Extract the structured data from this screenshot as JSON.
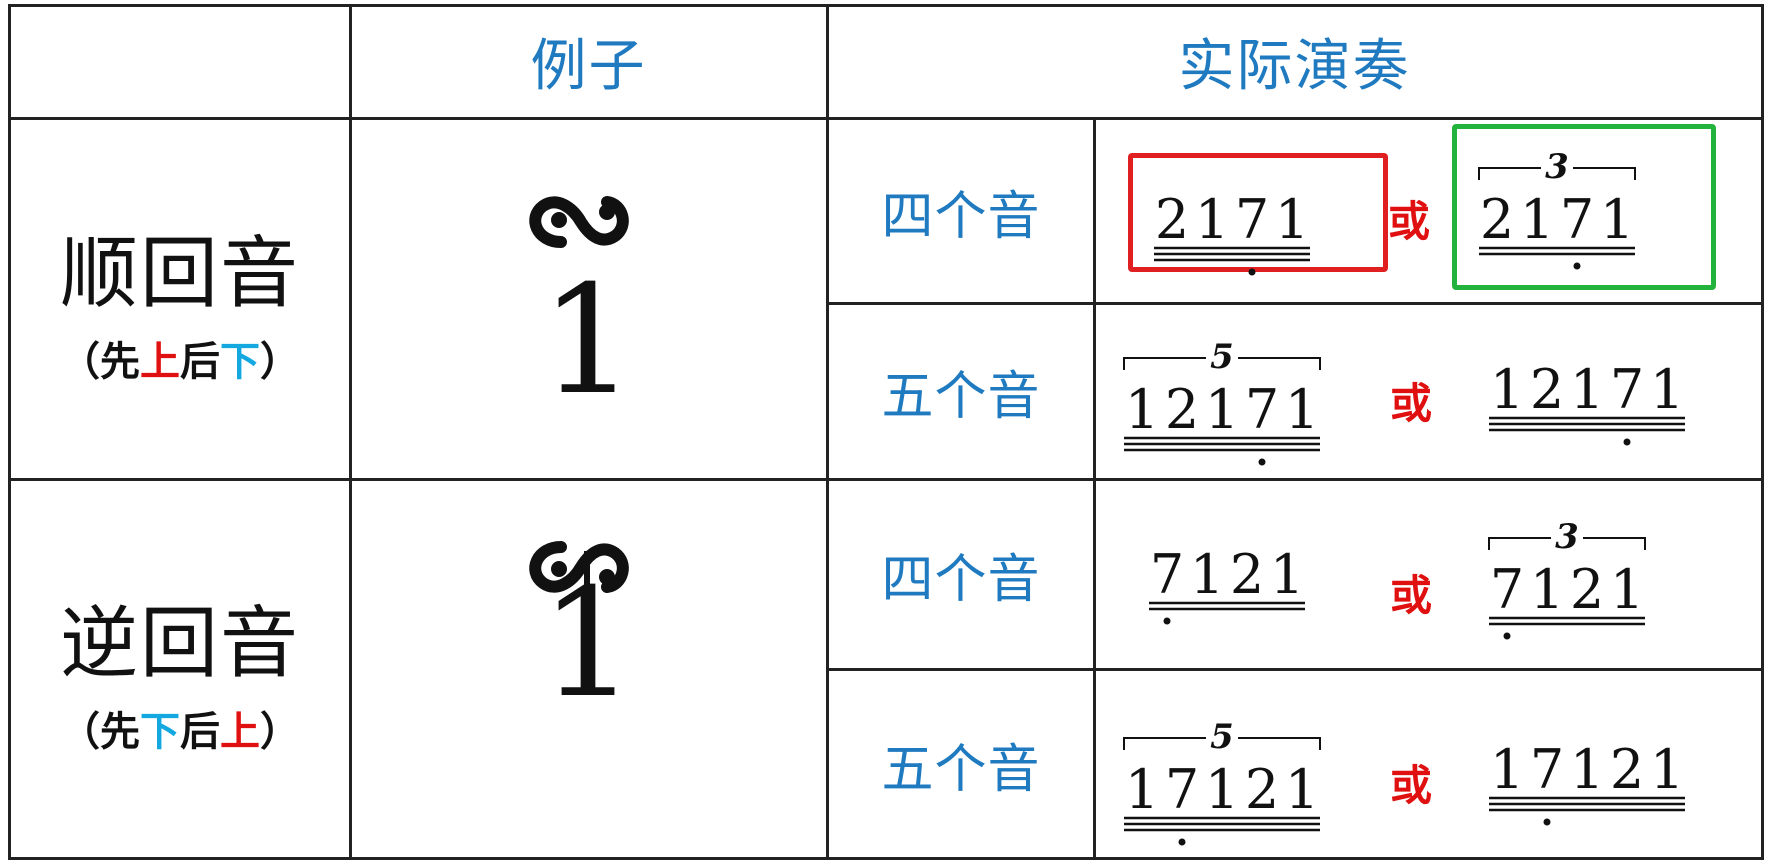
{
  "header": {
    "example": "例子",
    "performance": "实际演奏"
  },
  "rows": [
    {
      "title": "顺回音",
      "order": {
        "open": "（",
        "first": "先",
        "a": "上",
        "mid": "后",
        "b": "下",
        "close": "）"
      },
      "example_digit": "1",
      "example_symbol": "turn",
      "variants": [
        {
          "label": "四个音",
          "left": {
            "digits": [
              "2",
              "1",
              "7",
              "1"
            ],
            "tuplet": ""
          },
          "or": "或",
          "right": {
            "digits": [
              "2",
              "1",
              "7",
              "1"
            ],
            "tuplet": "3"
          }
        },
        {
          "label": "五个音",
          "left": {
            "digits": [
              "1",
              "2",
              "1",
              "7",
              "1"
            ],
            "tuplet": "5"
          },
          "or": "或",
          "right": {
            "digits": [
              "1",
              "2",
              "1",
              "7",
              "1"
            ],
            "tuplet": ""
          }
        }
      ]
    },
    {
      "title": "逆回音",
      "order": {
        "open": "（",
        "first": "先",
        "a": "下",
        "mid": "后",
        "b": "上",
        "close": "）"
      },
      "example_digit": "1",
      "example_symbol": "inverted-turn",
      "variants": [
        {
          "label": "四个音",
          "left": {
            "digits": [
              "7",
              "1",
              "2",
              "1"
            ],
            "tuplet": ""
          },
          "or": "或",
          "right": {
            "digits": [
              "7",
              "1",
              "2",
              "1"
            ],
            "tuplet": "3"
          }
        },
        {
          "label": "五个音",
          "left": {
            "digits": [
              "1",
              "7",
              "1",
              "2",
              "1"
            ],
            "tuplet": "5"
          },
          "or": "或",
          "right": {
            "digits": [
              "1",
              "7",
              "1",
              "2",
              "1"
            ],
            "tuplet": ""
          }
        }
      ]
    }
  ],
  "colors": {
    "header_text": "#1f7ac0",
    "up_red": "#e01010",
    "down_cyan": "#14a8e0",
    "red_box": "#e02020",
    "green_box": "#22b33c"
  }
}
